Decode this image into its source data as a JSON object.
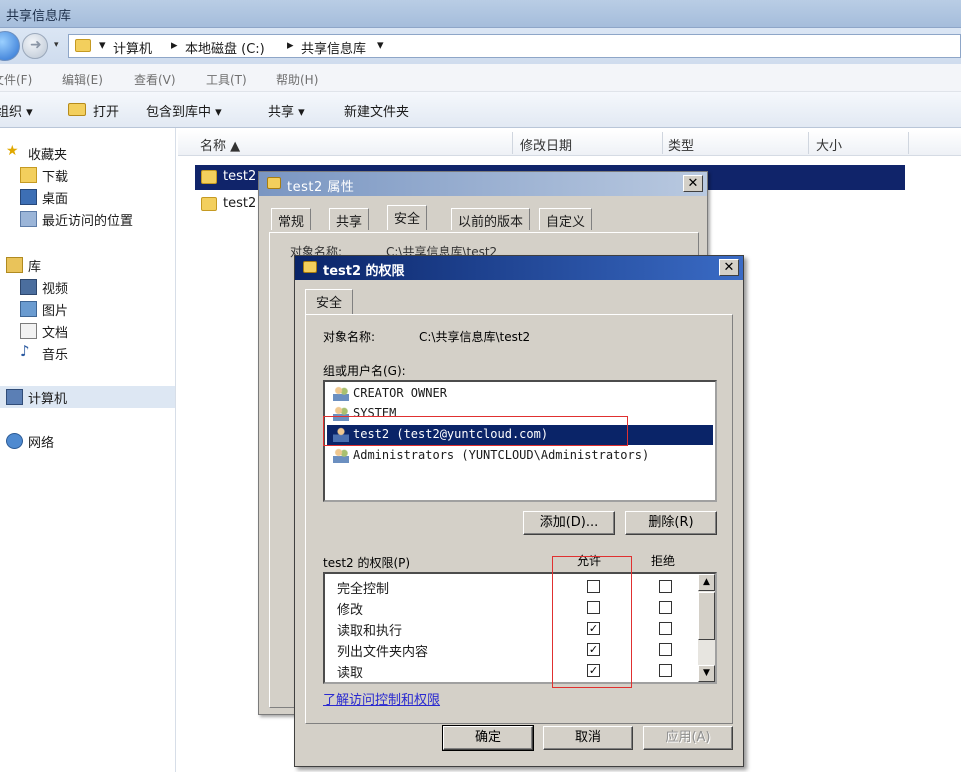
{
  "window": {
    "title": "共享信息库"
  },
  "address": {
    "crumbs": [
      "计算机",
      "本地磁盘 (C:)",
      "共享信息库"
    ],
    "dropdown_glyph": "▾",
    "separator_glyph": "▸"
  },
  "menu": [
    "文件(F)",
    "编辑(E)",
    "查看(V)",
    "工具(T)",
    "帮助(H)"
  ],
  "toolbar": {
    "organize": "组织 ▾",
    "open": "打开",
    "include_in_library": "包含到库中 ▾",
    "share": "共享 ▾",
    "new_folder": "新建文件夹"
  },
  "nav": {
    "favorites": "收藏夹",
    "downloads": "下载",
    "desktop": "桌面",
    "recent": "最近访问的位置",
    "libraries": "库",
    "videos": "视频",
    "pictures": "图片",
    "documents": "文档",
    "music": "音乐",
    "computer": "计算机",
    "network": "网络"
  },
  "columns": {
    "name": "名称 ▲",
    "modified": "修改日期",
    "type": "类型",
    "size": "大小"
  },
  "files": [
    {
      "name": "test2",
      "selected": true
    },
    {
      "name": "test2",
      "selected": false
    }
  ],
  "properties_dialog": {
    "title": "test2 属性",
    "tabs": [
      "常规",
      "共享",
      "安全",
      "以前的版本",
      "自定义"
    ],
    "active_tab": "安全",
    "ghost_object_label": "对象名称:",
    "ghost_object_value": "C:\\共享信息库\\test2"
  },
  "permissions_dialog": {
    "title": "test2 的权限",
    "tab": "安全",
    "object_label": "对象名称:",
    "object_value": "C:\\共享信息库\\test2",
    "group_label": "组或用户名(G):",
    "principals": [
      {
        "name": "CREATOR OWNER",
        "icon": "users-icon",
        "selected": false
      },
      {
        "name": "SYSTEM",
        "icon": "users-icon",
        "selected": false
      },
      {
        "name": "test2 (test2@yuntcloud.com)",
        "icon": "user-icon",
        "selected": true
      },
      {
        "name": "Administrators (YUNTCLOUD\\Administrators)",
        "icon": "users-icon",
        "selected": false
      }
    ],
    "add_button": "添加(D)...",
    "remove_button": "删除(R)",
    "perm_label": "test2 的权限(P)",
    "allow_header": "允许",
    "deny_header": "拒绝",
    "permissions": [
      {
        "name": "完全控制",
        "allow": false,
        "deny": false
      },
      {
        "name": "修改",
        "allow": false,
        "deny": false
      },
      {
        "name": "读取和执行",
        "allow": true,
        "deny": false
      },
      {
        "name": "列出文件夹内容",
        "allow": true,
        "deny": false
      },
      {
        "name": "读取",
        "allow": true,
        "deny": false
      }
    ],
    "learn_link": "了解访问控制和权限",
    "ok_button": "确定",
    "cancel_button": "取消",
    "apply_button": "应用(A)",
    "check_glyph": "✓"
  },
  "colors": {
    "highlight_box": "#e03030",
    "selection": "#0a2468",
    "dialog_face": "#d4d0c8"
  }
}
